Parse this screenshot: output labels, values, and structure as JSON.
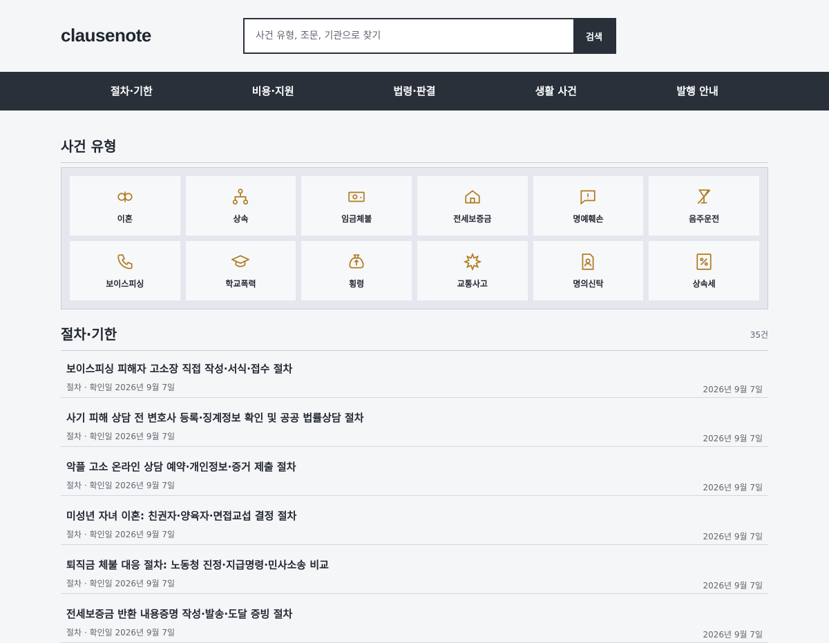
{
  "header": {
    "logo": "clausenote",
    "search_placeholder": "사건 유형, 조문, 기관으로 찾기",
    "search_button": "검색"
  },
  "nav": [
    "절차·기한",
    "비용·지원",
    "법령·판결",
    "생활 사건",
    "발행 안내"
  ],
  "categories_section": {
    "title": "사건 유형"
  },
  "categories": [
    {
      "label": "이혼",
      "icon": "divorce-icon"
    },
    {
      "label": "상속",
      "icon": "inheritance-icon"
    },
    {
      "label": "임금체불",
      "icon": "money-icon"
    },
    {
      "label": "전세보증금",
      "icon": "house-icon"
    },
    {
      "label": "명예훼손",
      "icon": "speech-alert-icon"
    },
    {
      "label": "음주운전",
      "icon": "no-drink-icon"
    },
    {
      "label": "보이스피싱",
      "icon": "phone-icon"
    },
    {
      "label": "학교폭력",
      "icon": "graduation-cap-icon"
    },
    {
      "label": "횡령",
      "icon": "money-bag-icon"
    },
    {
      "label": "교통사고",
      "icon": "crash-icon"
    },
    {
      "label": "명의신탁",
      "icon": "id-document-icon"
    },
    {
      "label": "상속세",
      "icon": "percent-icon"
    }
  ],
  "procedures_section": {
    "title": "절차·기한",
    "count": "35건"
  },
  "procedures": [
    {
      "title": "보이스피싱 피해자 고소장 직접 작성·서식·접수 절차",
      "meta": "절차 · 확인일 2026년 9월 7일",
      "date": "2026년 9월 7일"
    },
    {
      "title": "사기 피해 상담 전 변호사 등록·징계정보 확인 및 공공 법률상담 절차",
      "meta": "절차 · 확인일 2026년 9월 7일",
      "date": "2026년 9월 7일"
    },
    {
      "title": "악플 고소 온라인 상담 예약·개인정보·증거 제출 절차",
      "meta": "절차 · 확인일 2026년 9월 7일",
      "date": "2026년 9월 7일"
    },
    {
      "title": "미성년 자녀 이혼: 친권자·양육자·면접교섭 결정 절차",
      "meta": "절차 · 확인일 2026년 9월 7일",
      "date": "2026년 9월 7일"
    },
    {
      "title": "퇴직금 체불 대응 절차: 노동청 진정·지급명령·민사소송 비교",
      "meta": "절차 · 확인일 2026년 9월 7일",
      "date": "2026년 9월 7일"
    },
    {
      "title": "전세보증금 반환 내용증명 작성·발송·도달 증빙 절차",
      "meta": "절차 · 확인일 2026년 9월 7일",
      "date": "2026년 9월 7일"
    }
  ],
  "colors": {
    "dark": "#29303a",
    "accent": "#b07a1e",
    "background": "#f5f6f8"
  }
}
